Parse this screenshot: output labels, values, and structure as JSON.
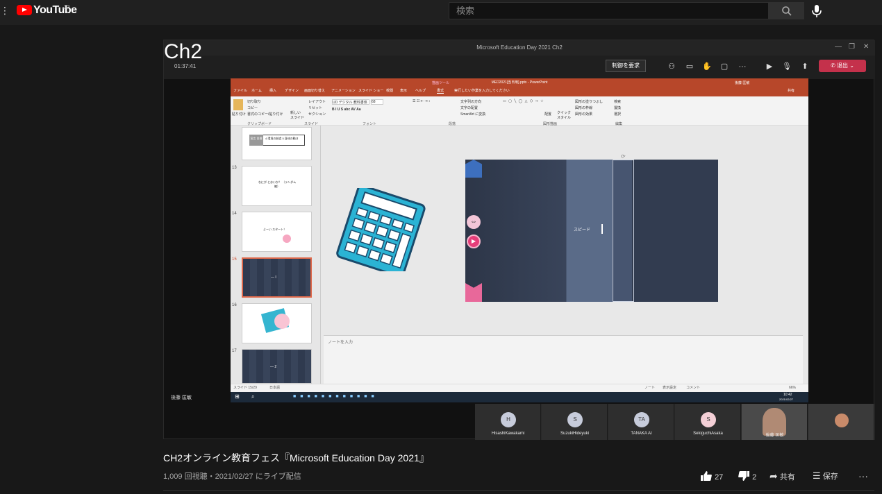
{
  "header": {
    "logo_text": "YouTube",
    "region": "JP",
    "search_placeholder": "検索"
  },
  "player": {
    "overlay_title": "Ch2",
    "timer": "01:37:41",
    "window_title": "Microsoft Education Day 2021 Ch2",
    "request_control": "制御を要求",
    "leave": "退出",
    "presenter": "後藤 匡敏",
    "ppt": {
      "file_title": "MED2021[当日用].pptx - PowerPoint",
      "tool_hint": "描画ツール",
      "tell_me": "実行したい作業を入力してください",
      "user": "後藤 匡敏",
      "share": "共有",
      "tabs": [
        "ファイル",
        "ホーム",
        "挿入",
        "デザイン",
        "画面切り替え",
        "アニメーション",
        "スライド ショー",
        "校閲",
        "表示",
        "ヘルプ",
        "書式"
      ],
      "ribbon_groups": [
        "クリップボード",
        "スライド",
        "フォント",
        "段落",
        "図形描画",
        "編集"
      ],
      "ribbon_items": {
        "paste": "貼り付け",
        "cut": "切り取り",
        "copy": "コピー",
        "format_painter": "書式のコピー/貼り付け",
        "new_slide": "新しい スライド",
        "layout": "レイアウト",
        "reset": "リセット",
        "section": "セクション",
        "font": "UD デジタル 教科書体",
        "size": "68",
        "text_direction": "文字列の方向",
        "align_text": "文字の配置",
        "smartart": "SmartArt に変換",
        "arrange": "配置",
        "quick_styles": "クイック スタイル",
        "shape_fill": "図形の塗りつぶし",
        "shape_outline": "図形の枠線",
        "shape_effects": "図形の効果",
        "find": "検索",
        "replace": "置換",
        "select": "選択"
      },
      "thumbs": [
        {
          "num": "",
          "text": "4 環境の創造 5 身体の動き",
          "tag": "宣言 目標"
        },
        {
          "num": "13",
          "text": "なにが とおいか？ （ランダム 編）"
        },
        {
          "num": "14",
          "text": "よーい スタート！"
        },
        {
          "num": "15",
          "text": "— I"
        },
        {
          "num": "16",
          "text": ""
        },
        {
          "num": "17",
          "text": "— 2"
        }
      ],
      "slide_text": "スピード",
      "notes_placeholder": "ノートを入力",
      "status_left": "スライド 15/29",
      "status_lang": "日本語",
      "status_notes": "ノート",
      "status_display": "表示設定",
      "status_comments": "コメント",
      "zoom": "66%",
      "clock_time": "10:42",
      "clock_date": "2021/02/27"
    },
    "participants": [
      {
        "initials": "H",
        "name": "HisashiKawakami"
      },
      {
        "initials": "S",
        "name": "SuzukiHideyuki"
      },
      {
        "initials": "TA",
        "name": "TANAKA AI"
      },
      {
        "initials": "S",
        "name": "SekiguchiAsaka"
      },
      {
        "initials": "",
        "name": "後藤 匡敏"
      },
      {
        "initials": "",
        "name": ""
      }
    ]
  },
  "video": {
    "title": "CH2オンライン教育フェス『Microsoft Education Day 2021』",
    "meta": "1,009 回視聴・2021/02/27 にライブ配信",
    "likes": "27",
    "dislikes": "2",
    "share": "共有",
    "save": "保存"
  },
  "colors": {
    "youtube_red": "#ff0000",
    "ppt_accent": "#b7472a",
    "teams_leave": "#c4314b"
  }
}
